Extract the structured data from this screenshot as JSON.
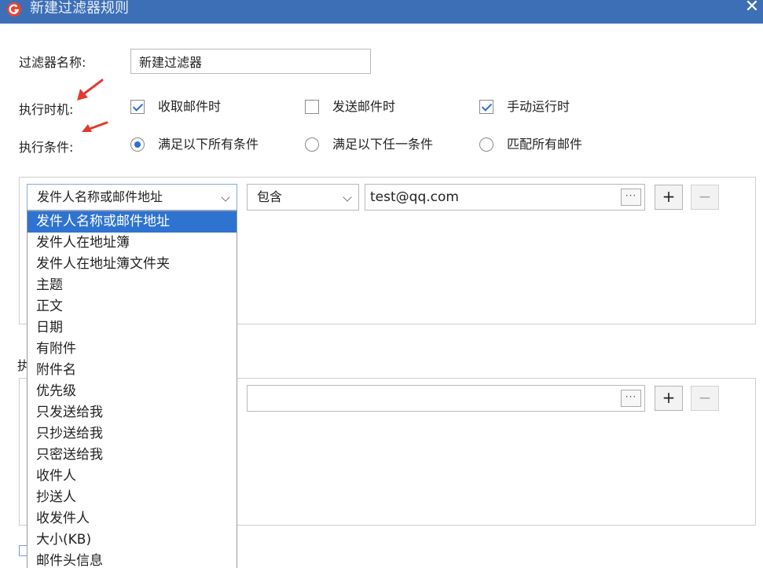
{
  "window": {
    "title": "新建过滤器规则",
    "close_glyph": "✕",
    "accent_color": "#3d6fb6"
  },
  "form": {
    "name_label": "过滤器名称:",
    "name_value": "新建过滤器",
    "timing_label": "执行时机:",
    "timing_options": [
      {
        "label": "收取邮件时",
        "checked": true
      },
      {
        "label": "发送邮件时",
        "checked": false
      },
      {
        "label": "手动运行时",
        "checked": true
      }
    ],
    "condition_label": "执行条件:",
    "condition_options": [
      {
        "label": "满足以下所有条件",
        "selected": true
      },
      {
        "label": "满足以下任一条件",
        "selected": false
      },
      {
        "label": "匹配所有邮件",
        "selected": false
      }
    ]
  },
  "condition_row": {
    "field_value": "发件人名称或邮件地址",
    "operator_value": "包含",
    "text_value": "test@qq.com",
    "browse_label": "···",
    "add_label": "+",
    "remove_label": "−"
  },
  "action_row": {
    "section_label_partial": "执",
    "text_value": "",
    "browse_label": "···",
    "add_label": "+",
    "remove_label": "−"
  },
  "field_dropdown": {
    "selected_index": 0,
    "options": [
      "发件人名称或邮件地址",
      "发件人在地址簿",
      "发件人在地址簿文件夹",
      "主题",
      "正文",
      "日期",
      "有附件",
      "附件名",
      "优先级",
      "只发送给我",
      "只抄送给我",
      "只密送给我",
      "收件人",
      "抄送人",
      "收发件人",
      "大小(KB)",
      "邮件头信息"
    ]
  },
  "annotations": {
    "arrow_color": "#e23a2e"
  }
}
